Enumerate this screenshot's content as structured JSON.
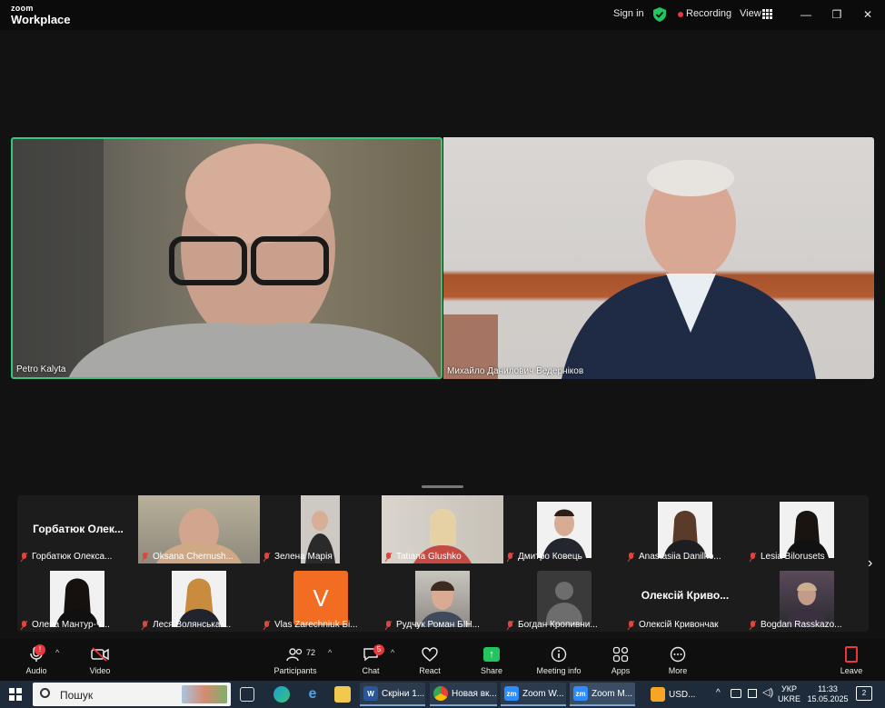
{
  "titlebar": {
    "logo_top": "zoom",
    "logo_bottom": "Workplace",
    "sign_in": "Sign in",
    "recording": "Recording",
    "view": "View",
    "minimize": "—",
    "restore": "❐",
    "close": "✕"
  },
  "colors": {
    "active_speaker_border": "#34c77b",
    "recording_dot": "#e8383d",
    "share_green": "#22c55e",
    "avatar_orange": "#f26d21"
  },
  "main_videos": [
    {
      "name": "Petro Kalyta"
    },
    {
      "name": "Михайло Данилович Ведерніков"
    }
  ],
  "gallery": {
    "row1": [
      {
        "label": "Горбатюк Олекса...",
        "big_name": "Горбатюк Олек...",
        "video": false
      },
      {
        "label": "Oksana Chernush...",
        "video": true
      },
      {
        "label": "Зелена Марія",
        "video": true
      },
      {
        "label": "Tatiana Glushko",
        "video": true
      },
      {
        "label": "Дмитро Ковець",
        "video": true
      },
      {
        "label": "Anastasiia Danilko...",
        "video": true
      },
      {
        "label": "Lesia Bilorusets",
        "video": true
      }
    ],
    "row2": [
      {
        "label": "Олена Мантур-Ч...",
        "video": true
      },
      {
        "label": "Леся Волянська-...",
        "video": true
      },
      {
        "label": "Vlas Zarechniuk Бі...",
        "avatar_letter": "V"
      },
      {
        "label": "Рудчук Роман БІН...",
        "video": true
      },
      {
        "label": "Богдан Кропивни...",
        "avatar": "generic"
      },
      {
        "label": "Олексій Кривончак",
        "big_name": "Олексій Криво..."
      },
      {
        "label": "Bogdan Rasskazo...",
        "video": true
      }
    ],
    "next_arrow": "›"
  },
  "toolbar": {
    "audio": "Audio",
    "audio_badge": "!",
    "video": "Video",
    "participants": "Participants",
    "participants_count": "72",
    "chat": "Chat",
    "chat_badge": "5",
    "react": "React",
    "share": "Share",
    "meeting_info": "Meeting info",
    "apps": "Apps",
    "more": "More",
    "leave": "Leave",
    "caret": "^"
  },
  "taskbar": {
    "search_text": "Пошук",
    "apps": [
      {
        "label": "Скріни 1...",
        "icon": "W"
      },
      {
        "label": "Новая вк...",
        "icon": ""
      },
      {
        "label": "Zoom W...",
        "icon": "zm"
      },
      {
        "label": "Zoom M...",
        "icon": "zm"
      },
      {
        "label": "USD...",
        "icon": ""
      }
    ],
    "lang_top": "УКР",
    "lang_bottom": "UKRE",
    "time": "11:33",
    "date": "15.05.2025",
    "notif_count": "2"
  }
}
